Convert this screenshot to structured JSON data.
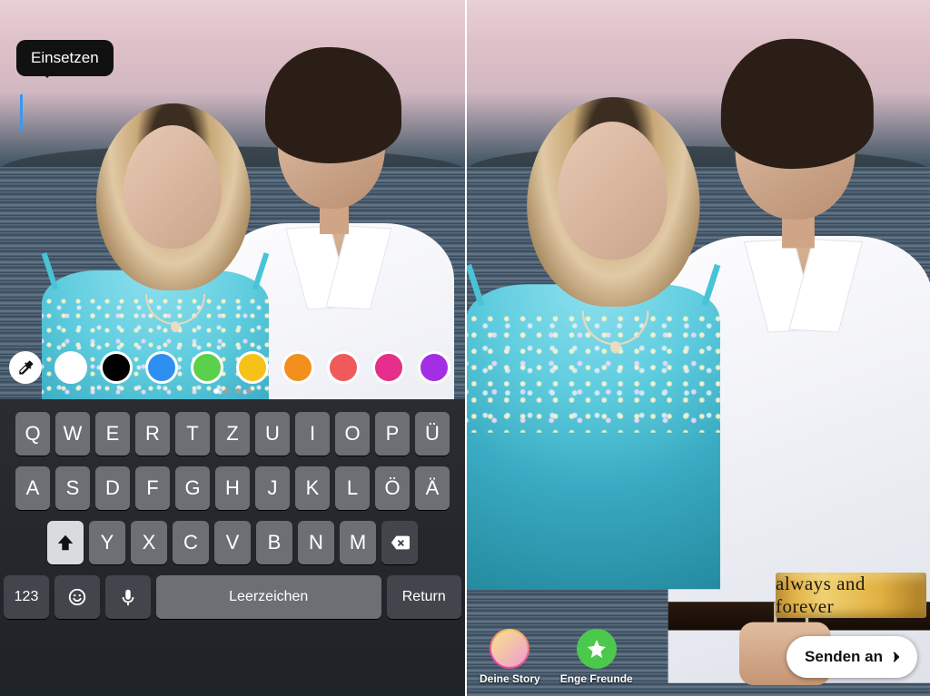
{
  "left": {
    "tooltip": "Einsetzen",
    "eyedropper_name": "eyedropper-icon",
    "colors": [
      "#ffffff",
      "#000000",
      "#2f8ff1",
      "#5bd04c",
      "#f6c21a",
      "#f38f1d",
      "#f05a5a",
      "#e62e8c",
      "#a32ee6"
    ],
    "page_indicator": {
      "count": 4,
      "active": 0
    },
    "keyboard": {
      "row1": [
        "Q",
        "W",
        "E",
        "R",
        "T",
        "Z",
        "U",
        "I",
        "O",
        "P",
        "Ü"
      ],
      "row2": [
        "A",
        "S",
        "D",
        "F",
        "G",
        "H",
        "J",
        "K",
        "L",
        "Ö",
        "Ä"
      ],
      "row3": [
        "Y",
        "X",
        "C",
        "V",
        "B",
        "N",
        "M"
      ],
      "shift_name": "shift-icon",
      "backspace_name": "backspace-icon",
      "numbers": "123",
      "emoji_name": "emoji-icon",
      "mic_name": "mic-icon",
      "space": "Leerzeichen",
      "return": "Return"
    }
  },
  "right": {
    "caption": "always and forever",
    "story_button": "Deine Story",
    "close_friends_button": "Enge Freunde",
    "send_button": "Senden an"
  }
}
